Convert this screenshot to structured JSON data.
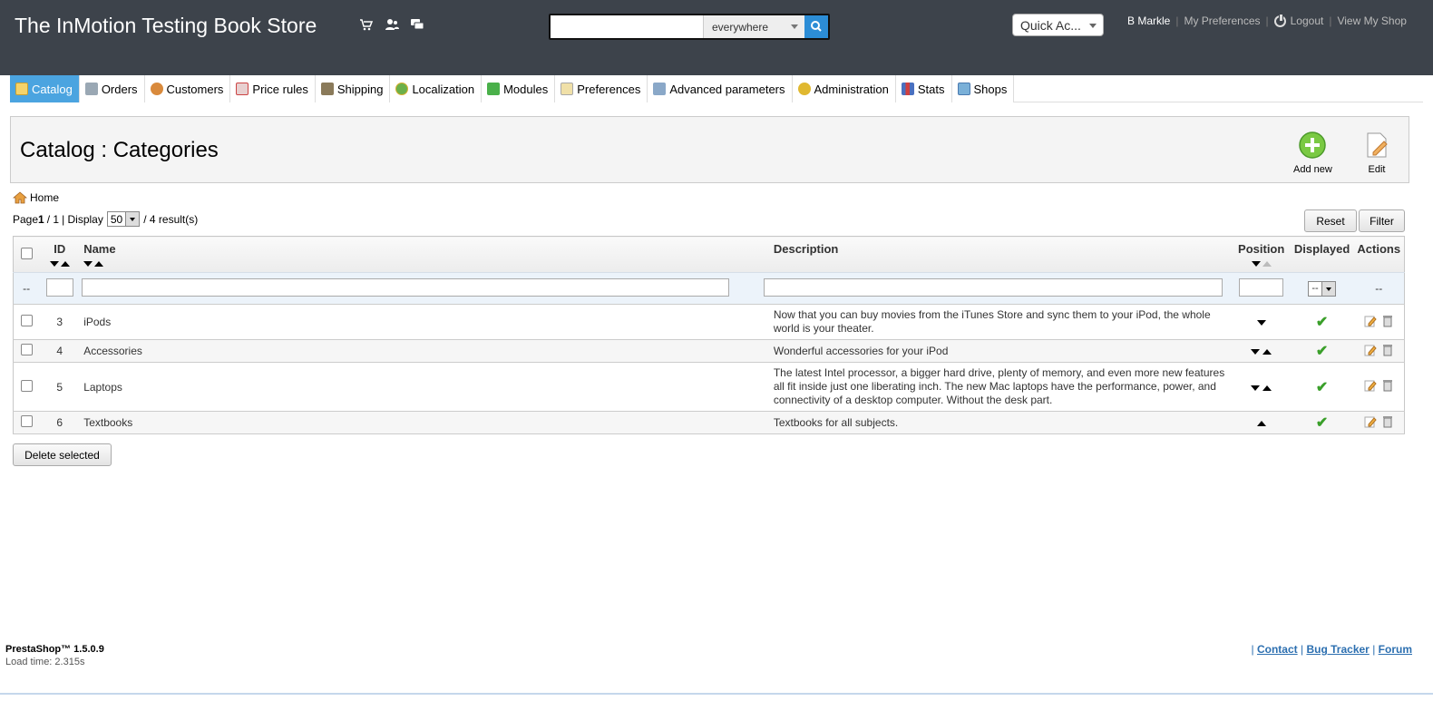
{
  "header": {
    "shop_title": "The InMotion Testing Book Store",
    "search_placeholder": "",
    "search_scope": "everywhere",
    "quick_access": "Quick Ac...",
    "user_name": "B Markle",
    "my_preferences": "My Preferences",
    "logout": "Logout",
    "view_shop": "View My Shop"
  },
  "tabs": [
    {
      "label": "Catalog",
      "icon": "folder-icon",
      "color": "#f0c040"
    },
    {
      "label": "Orders",
      "icon": "cart-icon",
      "color": "#8a9aa8"
    },
    {
      "label": "Customers",
      "icon": "customer-icon",
      "color": "#d98a3c"
    },
    {
      "label": "Price rules",
      "icon": "price-rules-icon",
      "color": "#c44"
    },
    {
      "label": "Shipping",
      "icon": "truck-icon",
      "color": "#7a6a4a"
    },
    {
      "label": "Localization",
      "icon": "globe-icon",
      "color": "#3a8a3a"
    },
    {
      "label": "Modules",
      "icon": "puzzle-icon",
      "color": "#3aa03a"
    },
    {
      "label": "Preferences",
      "icon": "preferences-icon",
      "color": "#d4a640"
    },
    {
      "label": "Advanced parameters",
      "icon": "wrench-icon",
      "color": "#6a8ab0"
    },
    {
      "label": "Administration",
      "icon": "key-icon",
      "color": "#d8b030"
    },
    {
      "label": "Stats",
      "icon": "stats-icon",
      "color": "#4a70c0"
    },
    {
      "label": "Shops",
      "icon": "shop-icon",
      "color": "#4a8ac0"
    }
  ],
  "page": {
    "title": "Catalog : Categories",
    "add_new": "Add new",
    "edit": "Edit",
    "breadcrumb_home": "Home",
    "page_label": "Page",
    "page_current": "1",
    "page_total": "/ 1",
    "display_label": "| Display",
    "display_value": "50",
    "results": "/ 4 result(s)",
    "reset": "Reset",
    "filter": "Filter",
    "delete_selected": "Delete selected"
  },
  "table": {
    "headers": {
      "id": "ID",
      "name": "Name",
      "description": "Description",
      "position": "Position",
      "displayed": "Displayed",
      "actions": "Actions"
    },
    "filter_dash": "--",
    "filter_displayed": "--",
    "filter_actions": "--",
    "rows": [
      {
        "id": "3",
        "name": "iPods",
        "description": "Now that you can buy movies from the iTunes Store and sync them to your iPod, the whole world is your theater."
      },
      {
        "id": "4",
        "name": "Accessories",
        "description": "Wonderful accessories for your iPod"
      },
      {
        "id": "5",
        "name": "Laptops",
        "description": "The latest Intel processor, a bigger hard drive, plenty of memory, and even more new features all fit inside just one liberating inch. The new Mac laptops have the performance, power, and connectivity of a desktop computer. Without the desk part."
      },
      {
        "id": "6",
        "name": "Textbooks",
        "description": "Textbooks for all subjects."
      }
    ]
  },
  "footer": {
    "version": "PrestaShop™ 1.5.0.9",
    "load_time": "Load time: 2.315s",
    "contact": "Contact",
    "bug_tracker": "Bug Tracker",
    "forum": "Forum",
    "sep": "|"
  }
}
